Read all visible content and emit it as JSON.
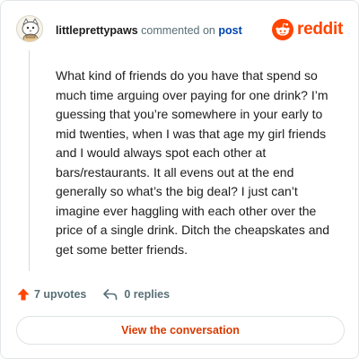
{
  "header": {
    "username": "littleprettypaws",
    "commented_on": "commented on",
    "post_link": "post"
  },
  "brand": {
    "name": "reddit",
    "logo_icon": "reddit-alien-icon",
    "color": "#ff4500"
  },
  "comment": {
    "text": "What kind of friends do you have that spend so much time arguing over paying for one drink? I’m guessing that you’re somewhere in your early to mid twenties, when I was that age my girl friends and I would always spot each other at bars/restaurants. It all evens out at the end generally so what’s the big deal? I just can’t imagine ever haggling with each other over the price of a single drink. Ditch the cheapskates and get some better friends."
  },
  "actions": {
    "upvotes": "7 upvotes",
    "replies": "0 replies",
    "upvote_icon": "upvote-arrow-icon",
    "reply_icon": "reply-arrow-icon",
    "upvote_color": "#ff4500"
  },
  "cta": {
    "label": "View the conversation",
    "color": "#d93a00"
  }
}
